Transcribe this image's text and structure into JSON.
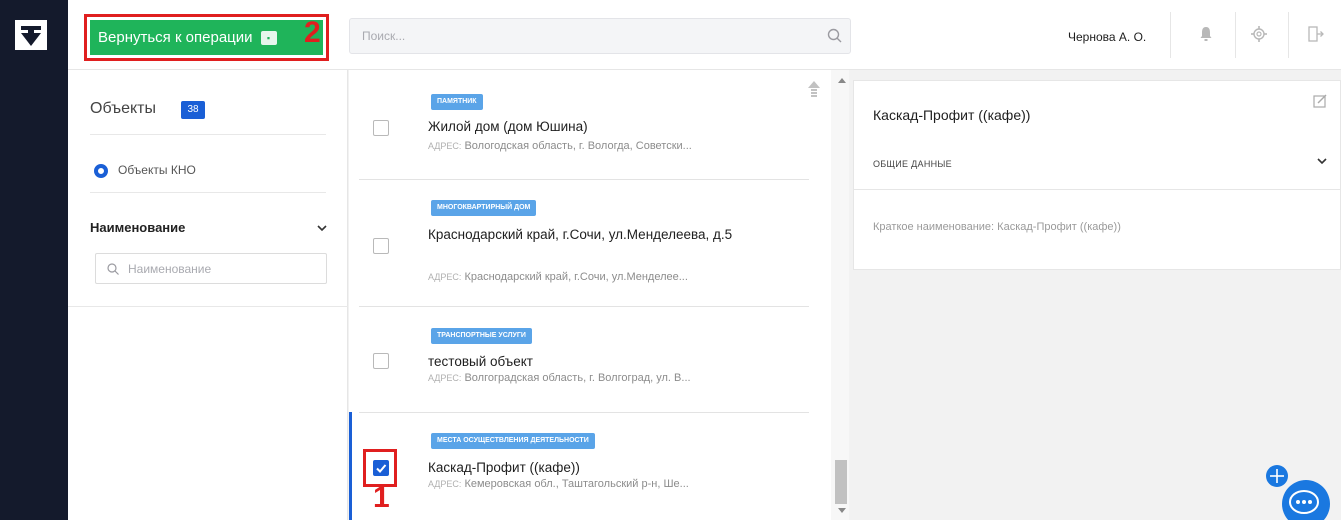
{
  "header": {
    "back_button_label": "Вернуться к операции",
    "annotation_2": "2",
    "search_placeholder": "Поиск...",
    "user_name": "Чернова А. О."
  },
  "filters": {
    "title": "Объекты",
    "count": "38",
    "radio_label": "Объекты КНО",
    "name_section_label": "Наименование",
    "name_input_placeholder": "Наименование"
  },
  "list": {
    "address_label": "АДРЕС:",
    "annotation_1": "1",
    "items": [
      {
        "tag": "памятник",
        "name": "Жилой дом (дом Юшина)",
        "address": "Вологодская область, г. Вологда, Советски...",
        "checked": false
      },
      {
        "tag": "многоквартирный дом",
        "name": "Краснодарский край, г.Сочи, ул.Менделеева, д.5",
        "address": "Краснодарский край, г.Сочи, ул.Менделее...",
        "checked": false
      },
      {
        "tag": "транспортные услуги",
        "name": "тестовый объект",
        "address": "Волгоградская область, г. Волгоград, ул. В...",
        "checked": false
      },
      {
        "tag": "места осуществления деятельности",
        "name": "Каскад-Профит ((кафе))",
        "address": "Кемеровская обл., Таштагольский р-н, Ше...",
        "checked": true
      }
    ]
  },
  "detail": {
    "title": "Каскад-Профит ((кафе))",
    "section": "ОБЩИЕ ДАННЫЕ",
    "short_name": "Краткое наименование: Каскад-Профит ((кафе))"
  },
  "colors": {
    "green_button": "#1fb45a",
    "accent_blue": "#1a5fd6",
    "annotation_red": "#e01f1f",
    "tag_blue": "#5aa4e8",
    "rail_dark": "#141a2c"
  },
  "icons": [
    "logo-shield-icon",
    "search-icon",
    "bell-icon",
    "gear-icon",
    "logout-icon",
    "chevron-down-icon",
    "scroll-top-icon",
    "edit-icon",
    "chat-icon",
    "move-icon"
  ]
}
